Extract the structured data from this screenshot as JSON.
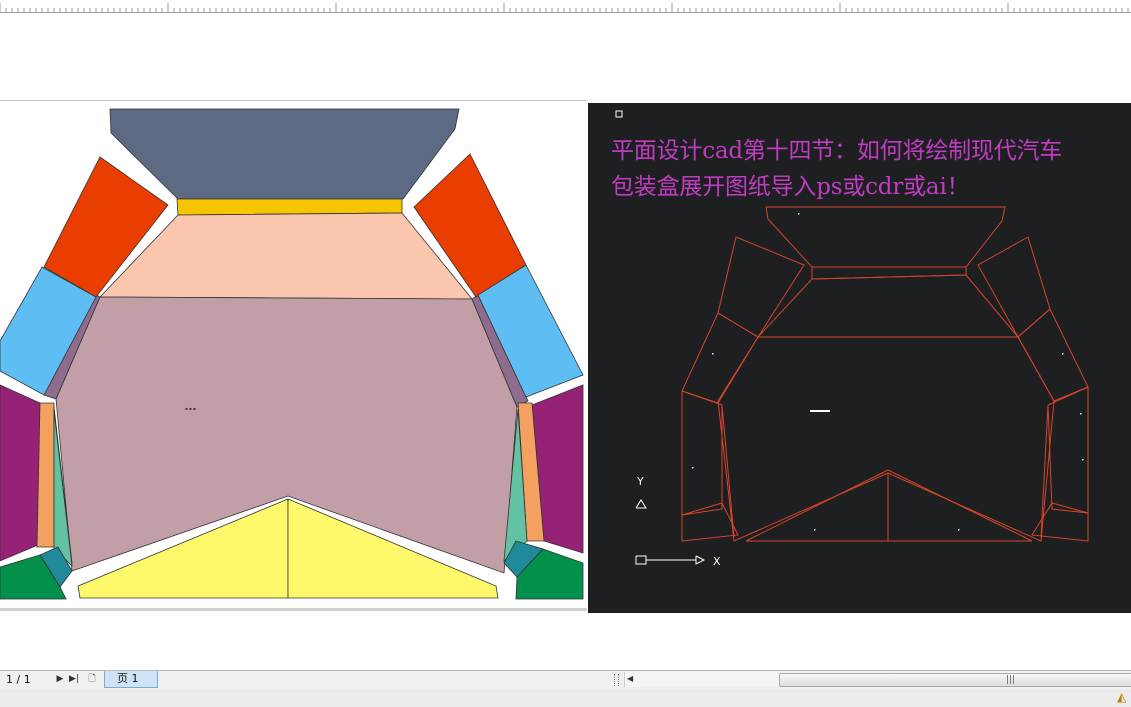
{
  "cad_panel": {
    "title_line1": "平面设计cad第十四节：如何将绘制现代汽车",
    "title_line2": "包装盒展开图纸导入ps或cdr或ai！",
    "axis_y_label": "Y",
    "axis_x_label": "X"
  },
  "statusbar": {
    "page_count": "1 / 1",
    "page_tab_label": "页 1",
    "scroll_grip": "|||"
  },
  "colors": {
    "top_flap": "#5d6a83",
    "yellow_strip": "#f6c400",
    "peach_panel": "#fbc6ae",
    "main_panel": "#c29ea7",
    "orange_flap": "#ea3d00",
    "blue_flap": "#5ebdf2",
    "purple_flap": "#962276",
    "side_strip_orange": "#f3a060",
    "side_strip_mint": "#62c2a2",
    "green_corner": "#03904a",
    "teal_corner": "#1f8a99",
    "light_yellow": "#fdf96b",
    "cad_line": "#d8452b",
    "cad_title": "#c13cc2"
  }
}
